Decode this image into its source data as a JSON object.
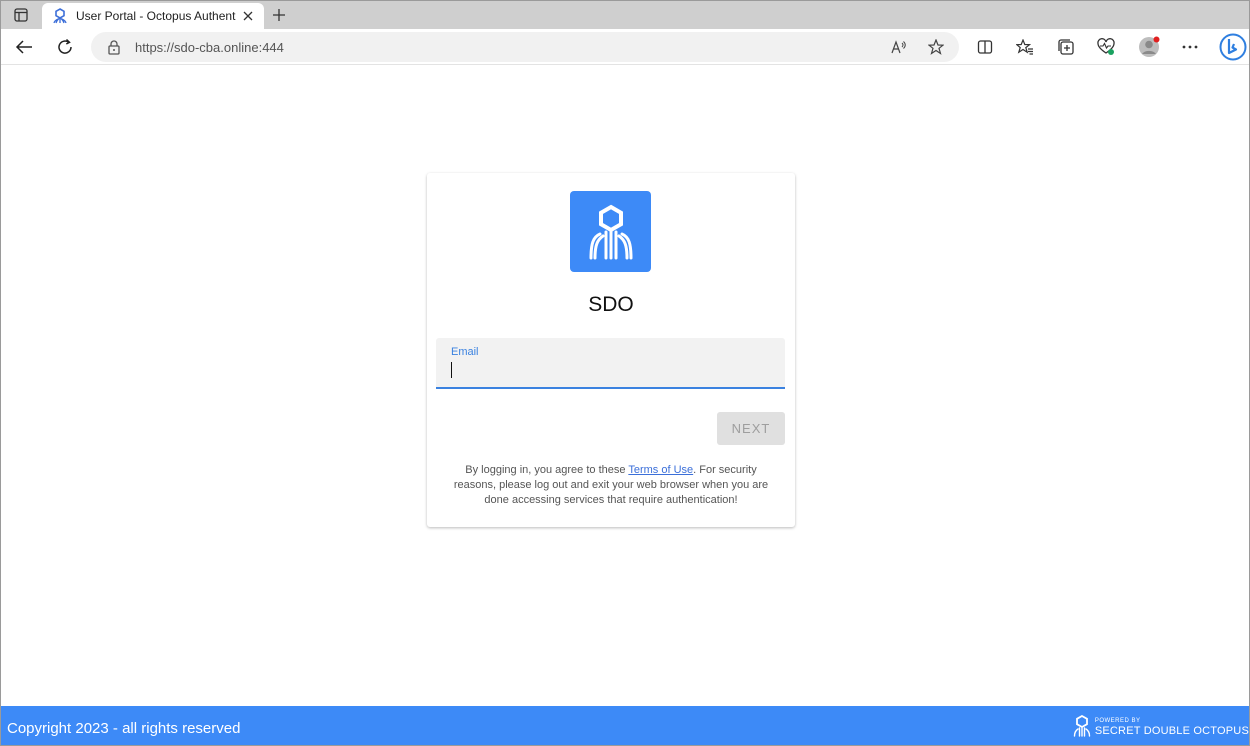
{
  "browser": {
    "tab_title": "User Portal - Octopus Authentica",
    "url": "https://sdo-cba.online:444"
  },
  "icons": {
    "tab_actions": "tab-actions-icon",
    "favicon": "octopus-icon",
    "close": "close-icon",
    "new_tab": "plus-icon",
    "back": "back-arrow-icon",
    "refresh": "refresh-icon",
    "lock": "lock-icon",
    "read_aloud": "read-aloud-icon",
    "favorite": "star-icon",
    "split_screen": "split-screen-icon",
    "favorites": "favorites-icon",
    "collections": "collections-icon",
    "performance": "heart-pulse-icon",
    "profile": "profile-avatar-icon",
    "menu": "more-icon",
    "bing": "bing-icon"
  },
  "login": {
    "org_name": "SDO",
    "email_label": "Email",
    "email_value": "",
    "next_label": "NEXT",
    "terms_prefix": "By logging in, you agree to these ",
    "terms_link": "Terms of Use",
    "terms_suffix": ". For security reasons, please log out and exit your web browser when you are done accessing services that require authentication!"
  },
  "footer": {
    "copyright": "Copyright 2023 - all rights reserved",
    "powered_by": "POWERED BY",
    "brand": "SECRET DOUBLE OCTOPUS"
  },
  "colors": {
    "brand_blue": "#3d8af7",
    "field_underline": "#3b82e0"
  }
}
